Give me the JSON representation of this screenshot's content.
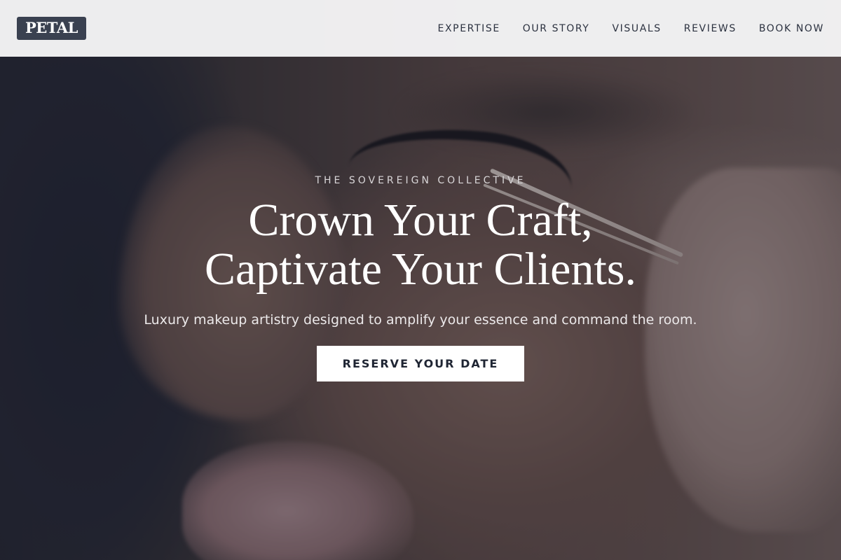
{
  "header": {
    "logo": "PETAL",
    "nav": [
      "EXPERTISE",
      "OUR STORY",
      "VISUALS",
      "REVIEWS",
      "BOOK NOW"
    ]
  },
  "hero": {
    "eyebrow": "THE SOVEREIGN COLLECTIVE",
    "headline_line1": "Crown Your Craft,",
    "headline_line2": "Captivate Your Clients.",
    "subhead": "Luxury makeup artistry designed to amplify your essence and command the room.",
    "cta_label": "RESERVE YOUR DATE",
    "background_image": "makeup-artist-applying-lashes"
  },
  "colors": {
    "logo_bg": "#3a4150",
    "nav_text": "#2c3240",
    "cta_bg": "#ffffff",
    "cta_text": "#1f2533"
  }
}
